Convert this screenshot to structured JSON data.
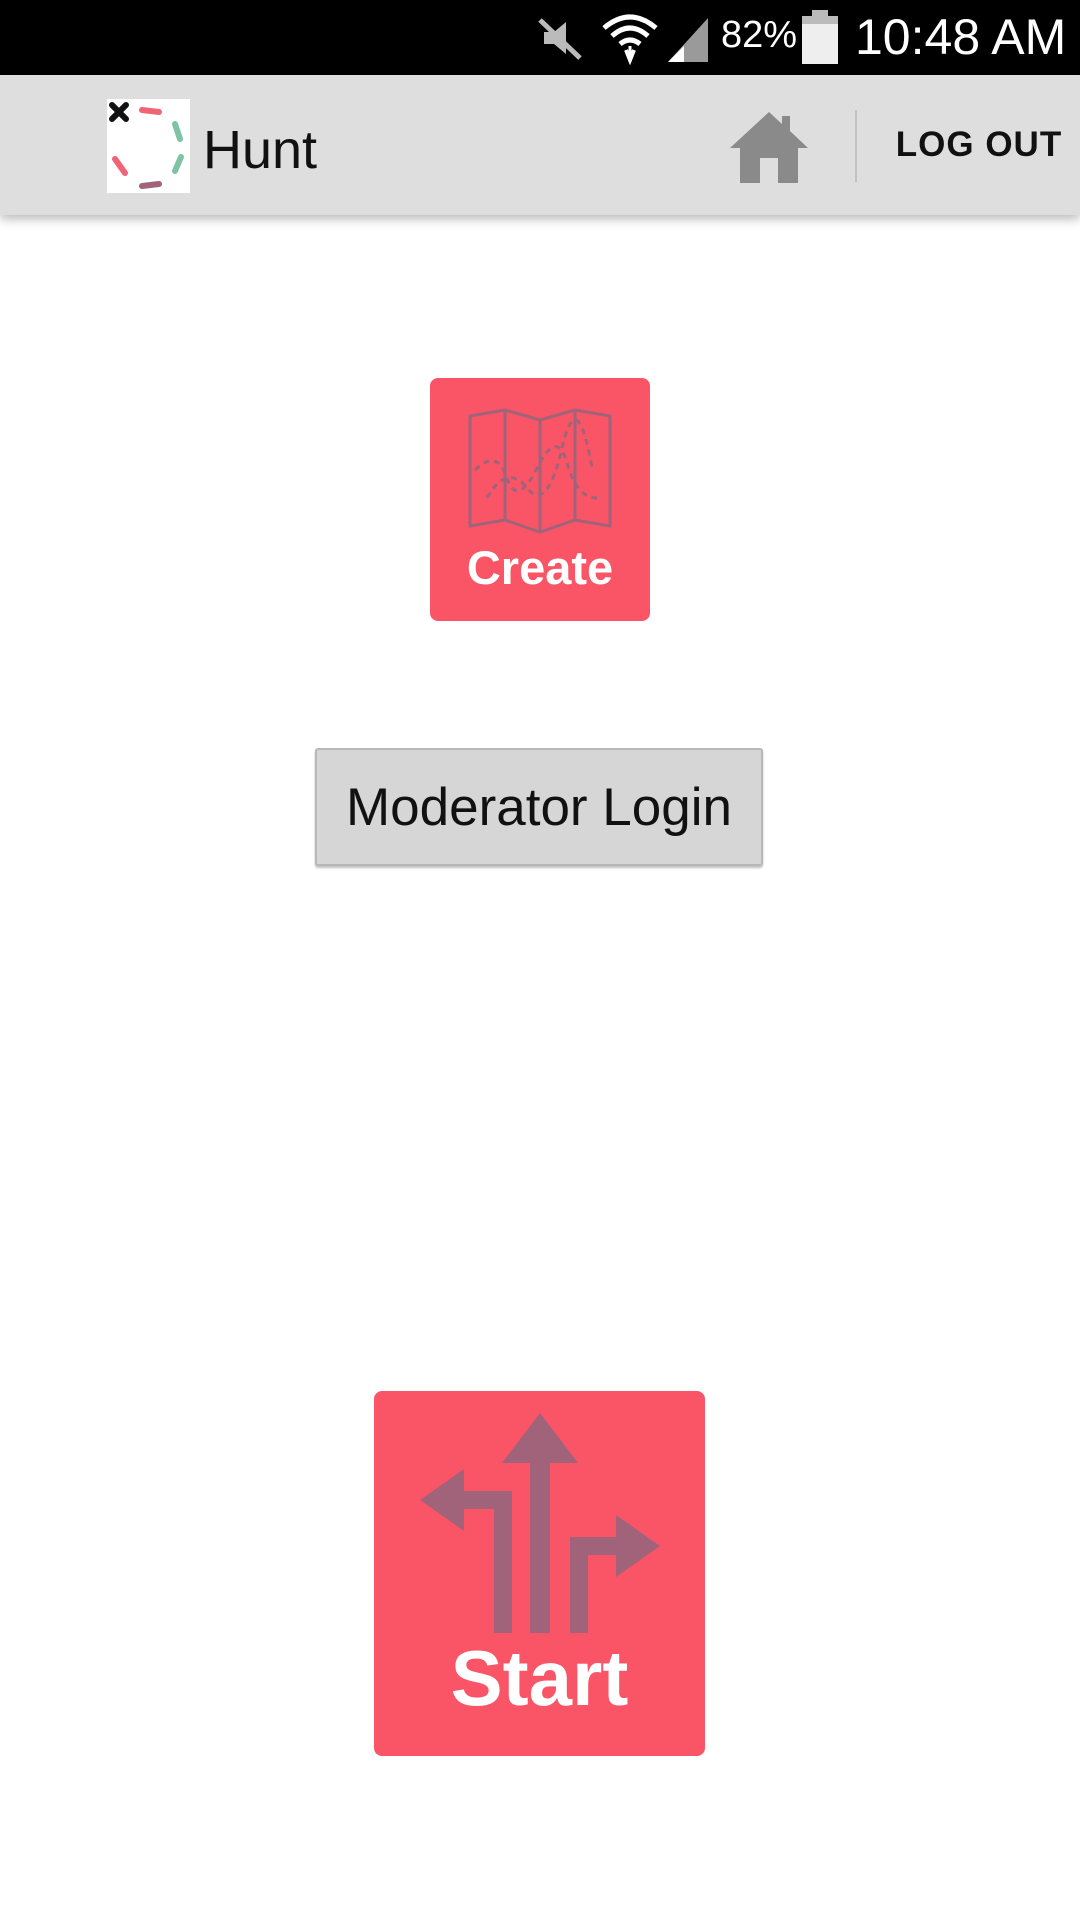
{
  "status_bar": {
    "battery_percent": "82%",
    "time": "10:48 AM",
    "icons": [
      "mute-icon",
      "wifi-icon",
      "signal-icon",
      "battery-icon"
    ]
  },
  "action_bar": {
    "app_title": "Hunt",
    "logout_label": "LOG OUT",
    "icons": [
      "app-logo-icon",
      "home-icon"
    ]
  },
  "main": {
    "create_label": "Create",
    "moderator_login_label": "Moderator Login",
    "start_label": "Start",
    "icons": [
      "map-icon",
      "directions-icon"
    ]
  },
  "colors": {
    "accent": "#f95566",
    "icon_muted": "#a0637a",
    "action_bar_bg": "#dedede",
    "status_bar_bg": "#000000"
  }
}
